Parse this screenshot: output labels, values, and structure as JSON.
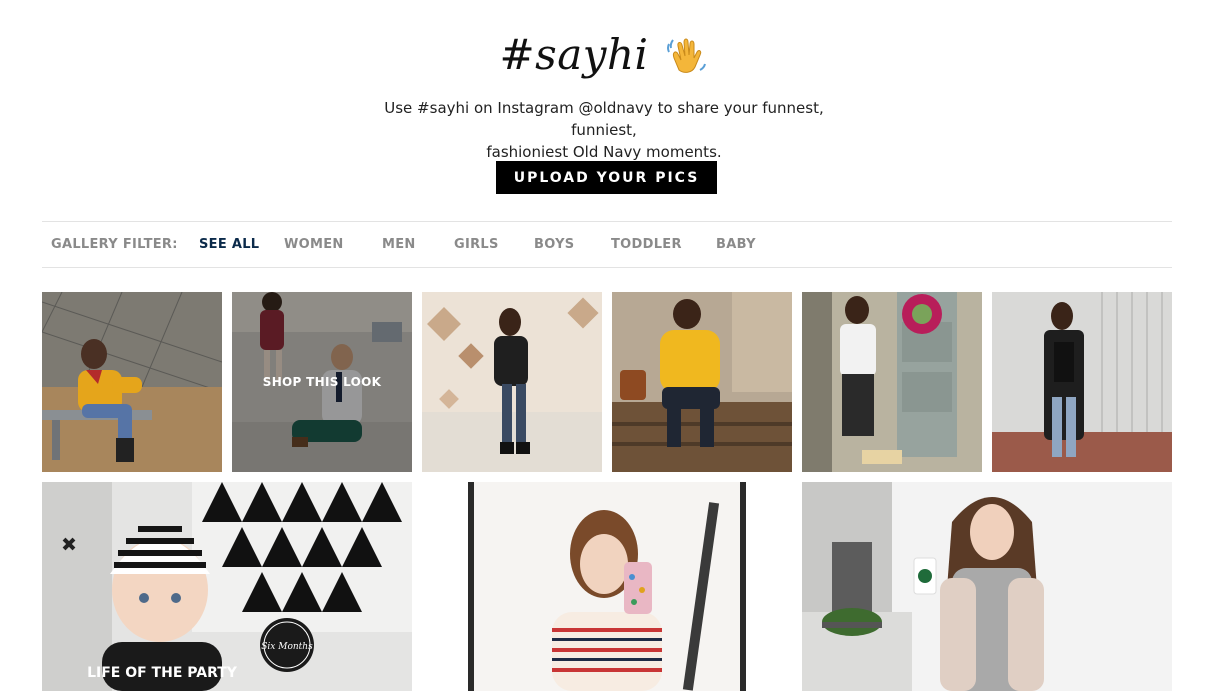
{
  "header": {
    "title": "#sayhi",
    "wave_icon": "waving-hand-icon",
    "subtitle_line1": "Use #sayhi on Instagram @oldnavy to share your funnest, funniest,",
    "subtitle_line2": "fashioniest Old Navy moments.",
    "upload_label": "UPLOAD YOUR PICS"
  },
  "filter": {
    "label": "GALLERY FILTER:",
    "items": [
      "SEE ALL",
      "WOMEN",
      "MEN",
      "GIRLS",
      "BOYS",
      "TODDLER",
      "BABY"
    ],
    "active": "SEE ALL"
  },
  "gallery": {
    "hover_label": "SHOP THIS LOOK",
    "tiles": [
      {
        "name": "photo-woman-yellow-sweater-bench"
      },
      {
        "name": "photo-father-daughter-street"
      },
      {
        "name": "photo-woman-black-jacket"
      },
      {
        "name": "photo-woman-yellow-sweatshirt"
      },
      {
        "name": "photo-woman-graphic-tank-door"
      },
      {
        "name": "photo-woman-long-cardigan"
      },
      {
        "name": "photo-baby-striped-beanie"
      },
      {
        "name": "photo-woman-striped-sweater-selfie"
      },
      {
        "name": "photo-woman-fur-vest-coffee"
      }
    ],
    "badge_text": "Six Months",
    "tee_text": "LIFE OF THE PARTY"
  },
  "colors": {
    "button_bg": "#000000",
    "active_filter": "#0b2a4a",
    "inactive_filter": "#8a8a8a"
  }
}
